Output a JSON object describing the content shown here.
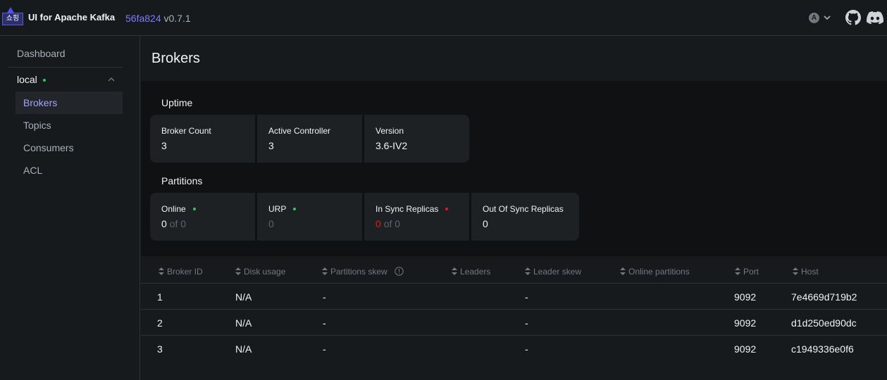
{
  "header": {
    "logo_text": "쇼핑",
    "app_title": "UI for Apache Kafka",
    "commit": "56fa824",
    "version": "v0.7.1",
    "user_initial": "A"
  },
  "sidebar": {
    "dashboard": "Dashboard",
    "cluster": "local",
    "cluster_status_color": "#2ec95c",
    "items": [
      {
        "label": "Brokers",
        "active": true
      },
      {
        "label": "Topics"
      },
      {
        "label": "Consumers"
      },
      {
        "label": "ACL"
      }
    ]
  },
  "page": {
    "title": "Brokers",
    "uptime": {
      "title": "Uptime",
      "metrics": [
        {
          "label": "Broker Count",
          "value": "3"
        },
        {
          "label": "Active Controller",
          "value": "3"
        },
        {
          "label": "Version",
          "value": "3.6-IV2"
        }
      ]
    },
    "partitions": {
      "title": "Partitions",
      "metrics": [
        {
          "label": "Online",
          "value": "0",
          "suffix": "of 0",
          "dot": "#2ec95c"
        },
        {
          "label": "URP",
          "value": "0",
          "dot": "#2ec95c"
        },
        {
          "label": "In Sync Replicas",
          "value": "0",
          "suffix": "of 0",
          "dot": "#e51a1a"
        },
        {
          "label": "Out Of Sync Replicas",
          "value": "0"
        }
      ]
    }
  },
  "table": {
    "columns": [
      "Broker ID",
      "Disk usage",
      "Partitions skew",
      "Leaders",
      "Leader skew",
      "Online partitions",
      "Port",
      "Host"
    ],
    "rows": [
      {
        "id": "1",
        "disk": "N/A",
        "pskew": "-",
        "lskew": "-",
        "port": "9092",
        "host": "7e4669d719b2"
      },
      {
        "id": "2",
        "disk": "N/A",
        "pskew": "-",
        "lskew": "-",
        "port": "9092",
        "host": "d1d250ed90dc"
      },
      {
        "id": "3",
        "disk": "N/A",
        "pskew": "-",
        "lskew": "-",
        "port": "9092",
        "host": "c1949336e0f6"
      }
    ]
  }
}
